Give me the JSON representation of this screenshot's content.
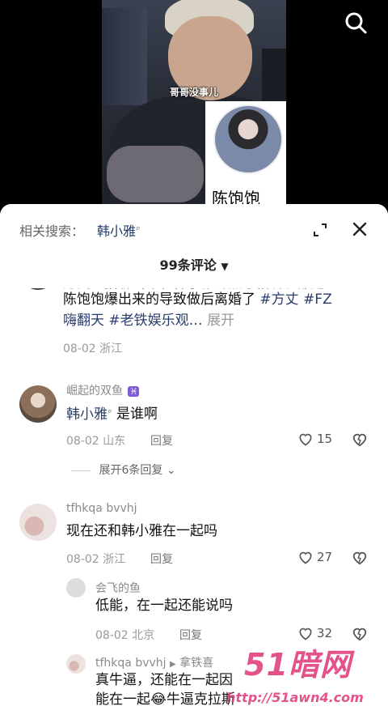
{
  "video": {
    "caption": "哥哥没事儿",
    "inset_name": "陈饱饱",
    "search_icon": "search-icon"
  },
  "sheet": {
    "related_label": "相关搜索：",
    "related_term": "韩小雅",
    "comment_count": "99条评论",
    "expand_icon": "expand-icon",
    "close_icon": "close-icon"
  },
  "comments": [
    {
      "text_line1_partial": "方丈直播聊当年和韩小雅的点才相说现都是",
      "text_line2": "陈饱饱爆出来的导致做后离婚了",
      "hashtag1": "#方丈",
      "hashtag2": "#FZ",
      "text_line3_tag1": "嗨翻天",
      "hashtag3": "#老铁娱乐观…",
      "more": "展开",
      "date": "08-02",
      "location": "浙江"
    },
    {
      "nick": "崛起的双鱼",
      "badge": "♓",
      "mention": "韩小雅",
      "text": "是谁啊",
      "date": "08-02",
      "location": "山东",
      "reply": "回复",
      "likes": "15",
      "expand": "展开6条回复"
    },
    {
      "nick": "tfhkqa bvvhj",
      "text": "现在还和韩小雅在一起吗",
      "date": "08-02",
      "location": "浙江",
      "reply": "回复",
      "likes": "27"
    },
    {
      "nick": "会飞的鱼",
      "text": "低能，在一起还能说吗",
      "date": "08-02",
      "location": "北京",
      "reply": "回复",
      "likes": "32"
    },
    {
      "nick": "tfhkqa bvvhj",
      "arrow": "▶",
      "reply_to": "拿铁喜",
      "text_line1": "真牛逼，还能在一起因",
      "text_line2": "能在一起😂牛逼克拉斯"
    }
  ],
  "watermark": {
    "logo": "51暗网",
    "url": "http://51awn4.com"
  }
}
